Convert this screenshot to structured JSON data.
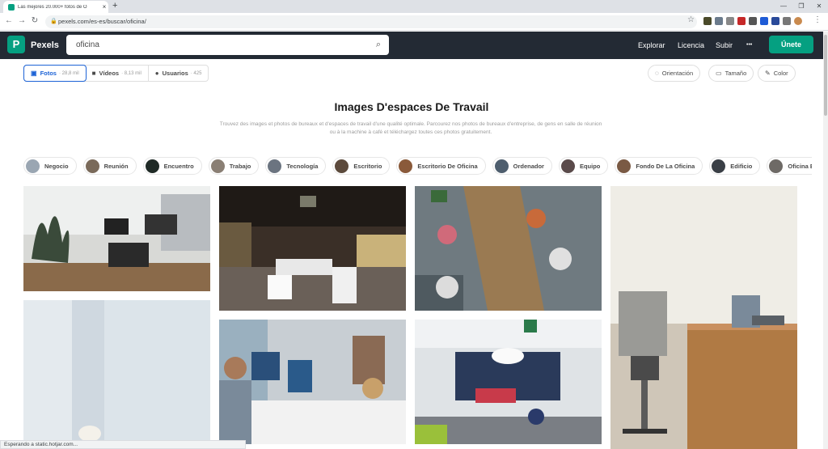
{
  "browser": {
    "tab_title": "Las mejores 20.000+ fotos de O",
    "tab_close": "×",
    "new_tab": "+",
    "url": "pexels.com/es-es/buscar/oficina/",
    "status": "Esperando a static.hotjar.com..."
  },
  "header": {
    "logo_letter": "P",
    "brand": "Pexels",
    "search_value": "oficina",
    "nav": [
      "Explorar",
      "Licencia",
      "Subir"
    ],
    "more": "•••",
    "join": "Únete"
  },
  "filters": {
    "tabs": [
      {
        "label": "Fotos",
        "count": "· 28,8 mil",
        "icon": "image-icon"
      },
      {
        "label": "Vídeos",
        "count": "· 8,13 mil",
        "icon": "video-icon"
      },
      {
        "label": "Usuarios",
        "count": "· 425",
        "icon": "user-icon"
      }
    ],
    "orientation": "Orientación",
    "size": "Tamaño",
    "color": "Color"
  },
  "page": {
    "title": "Images D'espaces De Travail",
    "description": "Trouvez des images et photos de bureaux et d'espaces de travail d'une qualité optimale. Parcourez nos photos de bureaux d'entreprise, de gens en salle de réunion ou à la machine à café et téléchargez toutes ces photos gratuitement."
  },
  "related": [
    "Negocio",
    "Reunión",
    "Encuentro",
    "Trabajo",
    "Tecnología",
    "Escritorio",
    "Escritorio De Oficina",
    "Ordenador",
    "Equipo",
    "Fondo De La Oficina",
    "Edificio",
    "Oficina En Casa"
  ],
  "colors": {
    "brand": "#05a081",
    "header_bg": "#232a34",
    "active_tab": "#1d63d6"
  }
}
